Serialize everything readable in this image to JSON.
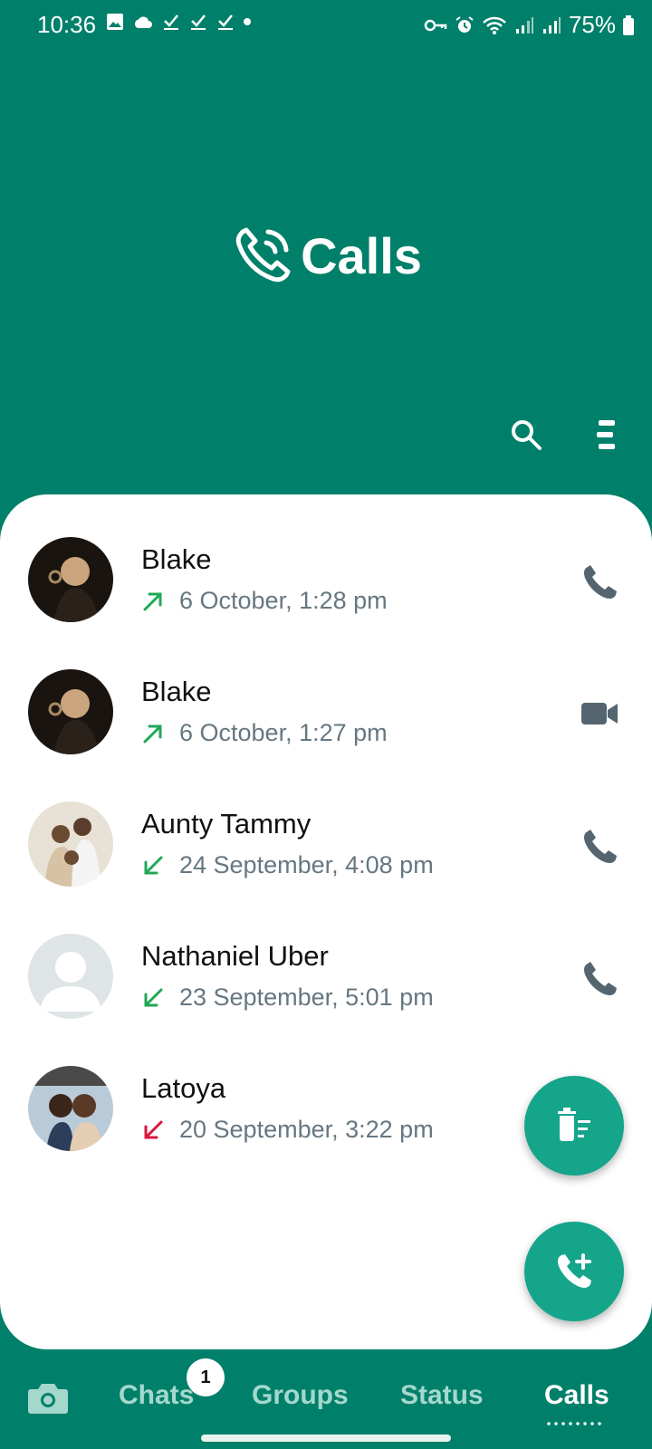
{
  "status_bar": {
    "time": "10:36",
    "battery": "75%"
  },
  "header": {
    "title": "Calls"
  },
  "calls": [
    {
      "name": "Blake",
      "timestamp": "6 October, 1:28 pm",
      "direction": "outgoing",
      "type": "voice",
      "arrow_color": "#1fa855"
    },
    {
      "name": "Blake",
      "timestamp": "6 October, 1:27 pm",
      "direction": "outgoing",
      "type": "video",
      "arrow_color": "#1fa855"
    },
    {
      "name": "Aunty Tammy",
      "timestamp": "24 September, 4:08 pm",
      "direction": "incoming",
      "type": "voice",
      "arrow_color": "#1fa855"
    },
    {
      "name": "Nathaniel Uber",
      "timestamp": "23 September, 5:01 pm",
      "direction": "incoming",
      "type": "voice",
      "arrow_color": "#1fa855"
    },
    {
      "name": "Latoya",
      "timestamp": "20 September, 3:22 pm",
      "direction": "missed",
      "type": "voice",
      "arrow_color": "#d9173f"
    }
  ],
  "bottom_nav": {
    "tabs": [
      {
        "label": "Chats"
      },
      {
        "label": "Groups"
      },
      {
        "label": "Status"
      },
      {
        "label": "Calls"
      }
    ],
    "chats_badge": "1"
  },
  "colors": {
    "primary": "#00806a",
    "fab": "#14a58b",
    "muted_text": "#667781",
    "icon": "#54656f"
  }
}
